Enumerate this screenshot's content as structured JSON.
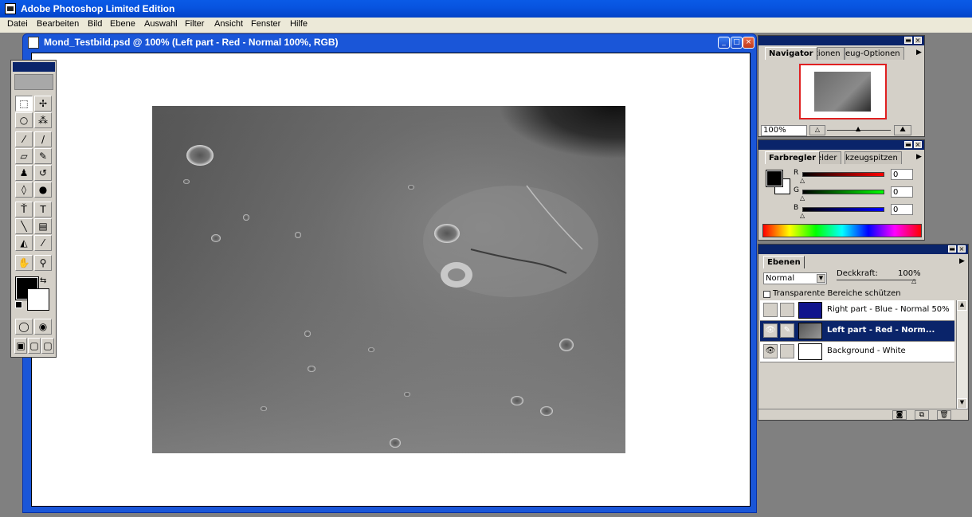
{
  "app": {
    "title": "Adobe Photoshop Limited Edition"
  },
  "menu": [
    "Datei",
    "Bearbeiten",
    "Bild",
    "Ebene",
    "Auswahl",
    "Filter",
    "Ansicht",
    "Fenster",
    "Hilfe"
  ],
  "document": {
    "title": "Mond_Testbild.psd @ 100%  (Left part - Red - Normal 100%, RGB)"
  },
  "navigator": {
    "tabs": [
      "Navigator",
      "tionen",
      "eug-Optionen"
    ],
    "zoom": "100%"
  },
  "color": {
    "tabs": [
      "Farbregler",
      "elder",
      "kzeugspitzen"
    ],
    "channels": [
      {
        "label": "R",
        "value": "0",
        "color": "#cc0000"
      },
      {
        "label": "G",
        "value": "0",
        "color": "#00aa00"
      },
      {
        "label": "B",
        "value": "0",
        "color": "#0000cc"
      }
    ]
  },
  "layers": {
    "tab": "Ebenen",
    "blend_mode": "Normal",
    "opacity_label": "Deckkraft:",
    "opacity_value": "100%",
    "preserve_label": "Transparente Bereiche schützen",
    "items": [
      {
        "name": "Right part - Blue - Normal 50%",
        "visible": false,
        "selected": false,
        "thumb": "#10148c"
      },
      {
        "name": "Left part - Red - Norm...",
        "visible": true,
        "selected": true,
        "thumb": "#777777"
      },
      {
        "name": "Background - White",
        "visible": true,
        "selected": false,
        "thumb": "#ffffff"
      }
    ]
  }
}
